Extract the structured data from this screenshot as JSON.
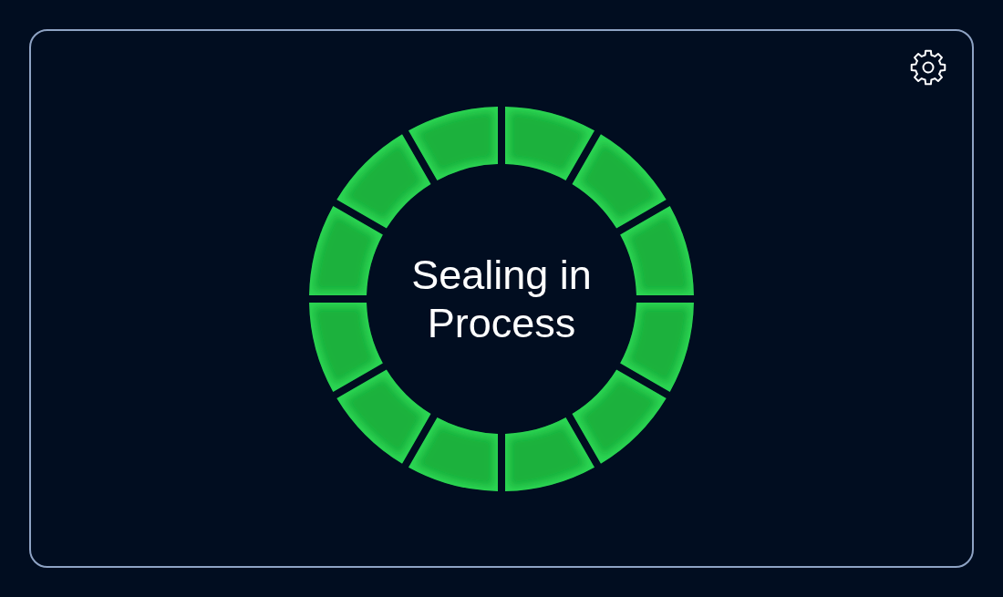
{
  "progress_ring": {
    "level": 1,
    "label": "Sealing in Process"
  }
}
